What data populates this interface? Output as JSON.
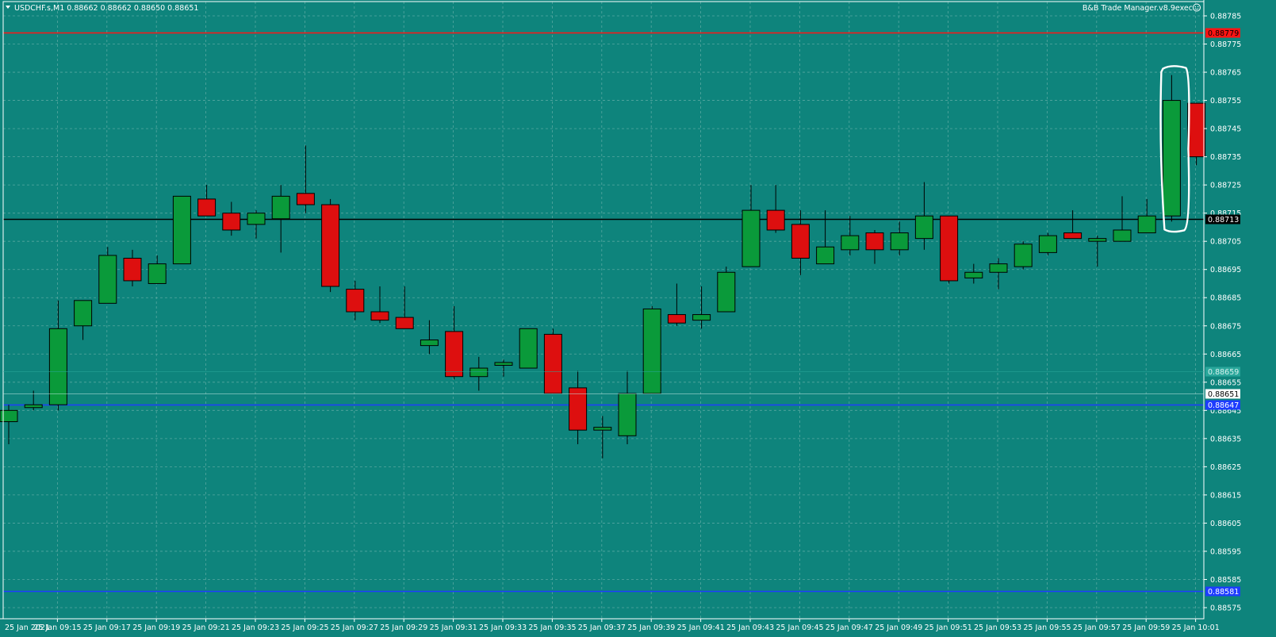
{
  "window": {
    "menu_icon": "triangle-down-icon",
    "symbol_header": "USDCHF.s,M1  0.88662 0.88662 0.88650 0.88651",
    "ea_label": "B&B Trade Manager.v8.9exec",
    "ea_icon": "smiley-face-icon",
    "first_date_label": "25 Jan 2021"
  },
  "colors": {
    "background": "#0e847c",
    "grid": "#6fb3ad",
    "bull": "#0a9a3a",
    "bear": "#dd0f0f",
    "outline": "#000000",
    "axis_text": "#ffffff",
    "red_line": "#ff1414",
    "black_line": "#000000",
    "blue_line": "#1e3cff",
    "highlight_stroke": "#ffffff"
  },
  "chart_data": {
    "type": "candlestick",
    "symbol": "USDCHF.s",
    "timeframe": "M1",
    "x_labels": [
      "25 Jan 09:15",
      "25 Jan 09:17",
      "25 Jan 09:19",
      "25 Jan 09:21",
      "25 Jan 09:23",
      "25 Jan 09:25",
      "25 Jan 09:27",
      "25 Jan 09:29",
      "25 Jan 09:31",
      "25 Jan 09:33",
      "25 Jan 09:35",
      "25 Jan 09:37",
      "25 Jan 09:39",
      "25 Jan 09:41",
      "25 Jan 09:43",
      "25 Jan 09:45",
      "25 Jan 09:47",
      "25 Jan 09:49",
      "25 Jan 09:51",
      "25 Jan 09:53",
      "25 Jan 09:55",
      "25 Jan 09:57",
      "25 Jan 09:59",
      "25 Jan 10:01"
    ],
    "y_ticks": [
      "0.88785",
      "0.88775",
      "0.88765",
      "0.88755",
      "0.88745",
      "0.88735",
      "0.88725",
      "0.88715",
      "0.88705",
      "0.88695",
      "0.88685",
      "0.88675",
      "0.88665",
      "0.88655",
      "0.88645",
      "0.88635",
      "0.88625",
      "0.88615",
      "0.88605",
      "0.88595",
      "0.88585",
      "0.88575"
    ],
    "y_range": [
      0.88572,
      0.88788
    ],
    "candles": [
      {
        "o": 0.88641,
        "h": 0.88647,
        "l": 0.88633,
        "c": 0.88645
      },
      {
        "o": 0.88646,
        "h": 0.88652,
        "l": 0.88645,
        "c": 0.88647
      },
      {
        "o": 0.88647,
        "h": 0.88684,
        "l": 0.88645,
        "c": 0.88674
      },
      {
        "o": 0.88675,
        "h": 0.88675,
        "l": 0.8867,
        "c": 0.88684
      },
      {
        "o": 0.88683,
        "h": 0.88703,
        "l": 0.88683,
        "c": 0.887
      },
      {
        "o": 0.88699,
        "h": 0.88702,
        "l": 0.88689,
        "c": 0.88691
      },
      {
        "o": 0.8869,
        "h": 0.887,
        "l": 0.8869,
        "c": 0.88697
      },
      {
        "o": 0.88697,
        "h": 0.88721,
        "l": 0.88697,
        "c": 0.88721
      },
      {
        "o": 0.8872,
        "h": 0.88725,
        "l": 0.88714,
        "c": 0.88714
      },
      {
        "o": 0.88715,
        "h": 0.88719,
        "l": 0.88707,
        "c": 0.88709
      },
      {
        "o": 0.88711,
        "h": 0.88716,
        "l": 0.88706,
        "c": 0.88715
      },
      {
        "o": 0.88713,
        "h": 0.88725,
        "l": 0.88701,
        "c": 0.88721
      },
      {
        "o": 0.88722,
        "h": 0.88739,
        "l": 0.88715,
        "c": 0.88718
      },
      {
        "o": 0.88718,
        "h": 0.8872,
        "l": 0.88687,
        "c": 0.88689
      },
      {
        "o": 0.88688,
        "h": 0.88691,
        "l": 0.88677,
        "c": 0.8868
      },
      {
        "o": 0.8868,
        "h": 0.88689,
        "l": 0.88676,
        "c": 0.88677
      },
      {
        "o": 0.88678,
        "h": 0.88689,
        "l": 0.88675,
        "c": 0.88674
      },
      {
        "o": 0.88668,
        "h": 0.88677,
        "l": 0.88665,
        "c": 0.8867
      },
      {
        "o": 0.88673,
        "h": 0.88682,
        "l": 0.88656,
        "c": 0.88657
      },
      {
        "o": 0.88657,
        "h": 0.88664,
        "l": 0.88652,
        "c": 0.8866
      },
      {
        "o": 0.88661,
        "h": 0.88663,
        "l": 0.88657,
        "c": 0.88662
      },
      {
        "o": 0.8866,
        "h": 0.88674,
        "l": 0.8866,
        "c": 0.88674
      },
      {
        "o": 0.88672,
        "h": 0.88674,
        "l": 0.88651,
        "c": 0.88651
      },
      {
        "o": 0.88653,
        "h": 0.88659,
        "l": 0.88633,
        "c": 0.88638
      },
      {
        "o": 0.88638,
        "h": 0.88643,
        "l": 0.88628,
        "c": 0.88639
      },
      {
        "o": 0.88636,
        "h": 0.88659,
        "l": 0.88633,
        "c": 0.88651
      },
      {
        "o": 0.88651,
        "h": 0.88682,
        "l": 0.88651,
        "c": 0.88681
      },
      {
        "o": 0.88679,
        "h": 0.8869,
        "l": 0.88675,
        "c": 0.88676
      },
      {
        "o": 0.88677,
        "h": 0.88689,
        "l": 0.88674,
        "c": 0.88679
      },
      {
        "o": 0.8868,
        "h": 0.88696,
        "l": 0.8868,
        "c": 0.88694
      },
      {
        "o": 0.88696,
        "h": 0.88725,
        "l": 0.88696,
        "c": 0.88716
      },
      {
        "o": 0.88716,
        "h": 0.88725,
        "l": 0.88708,
        "c": 0.88709
      },
      {
        "o": 0.88711,
        "h": 0.88716,
        "l": 0.88693,
        "c": 0.88699
      },
      {
        "o": 0.88697,
        "h": 0.88716,
        "l": 0.88697,
        "c": 0.88703
      },
      {
        "o": 0.88702,
        "h": 0.88714,
        "l": 0.887,
        "c": 0.88707
      },
      {
        "o": 0.88708,
        "h": 0.88709,
        "l": 0.88697,
        "c": 0.88702
      },
      {
        "o": 0.88702,
        "h": 0.88712,
        "l": 0.887,
        "c": 0.88708
      },
      {
        "o": 0.88706,
        "h": 0.88726,
        "l": 0.88702,
        "c": 0.88714
      },
      {
        "o": 0.88714,
        "h": 0.88714,
        "l": 0.8869,
        "c": 0.88691
      },
      {
        "o": 0.88692,
        "h": 0.88697,
        "l": 0.8869,
        "c": 0.88694
      },
      {
        "o": 0.88694,
        "h": 0.88699,
        "l": 0.88688,
        "c": 0.88697
      },
      {
        "o": 0.88696,
        "h": 0.88705,
        "l": 0.88695,
        "c": 0.88704
      },
      {
        "o": 0.88701,
        "h": 0.88708,
        "l": 0.887,
        "c": 0.88707
      },
      {
        "o": 0.88708,
        "h": 0.88716,
        "l": 0.88706,
        "c": 0.88706
      },
      {
        "o": 0.88705,
        "h": 0.88707,
        "l": 0.88696,
        "c": 0.88706
      },
      {
        "o": 0.88705,
        "h": 0.88721,
        "l": 0.88705,
        "c": 0.88709
      },
      {
        "o": 0.88708,
        "h": 0.8872,
        "l": 0.88708,
        "c": 0.88714
      },
      {
        "o": 0.88714,
        "h": 0.88764,
        "l": 0.88712,
        "c": 0.88755
      },
      {
        "o": 0.88754,
        "h": 0.88754,
        "l": 0.88732,
        "c": 0.88735
      }
    ],
    "highlighted_candle_index": 47,
    "horizontal_lines": [
      {
        "price": 0.88779,
        "label": "0.88779",
        "color": "#ff1414",
        "label_bg": "#ff1414",
        "label_fg": "#000000"
      },
      {
        "price": 0.88713,
        "label": "0.88713",
        "color": "#000000",
        "label_bg": "#000000",
        "label_fg": "#ffffff"
      },
      {
        "price": 0.88647,
        "label": "0.88647",
        "color": "#1e3cff",
        "label_bg": "#1e3cff",
        "label_fg": "#ffffff"
      },
      {
        "price": 0.88581,
        "label": "0.88581",
        "color": "#1e3cff",
        "label_bg": "#1e3cff",
        "label_fg": "#ffffff"
      }
    ],
    "price_markers": [
      {
        "price": 0.88659,
        "label": "0.88659",
        "bg": "#2aa79b",
        "fg": "#d6f1ee",
        "line": "#2aa79b"
      },
      {
        "price": 0.88651,
        "label": "0.88651",
        "bg": "#ffffff",
        "fg": "#000000",
        "line": "#bfe7e2"
      }
    ]
  }
}
